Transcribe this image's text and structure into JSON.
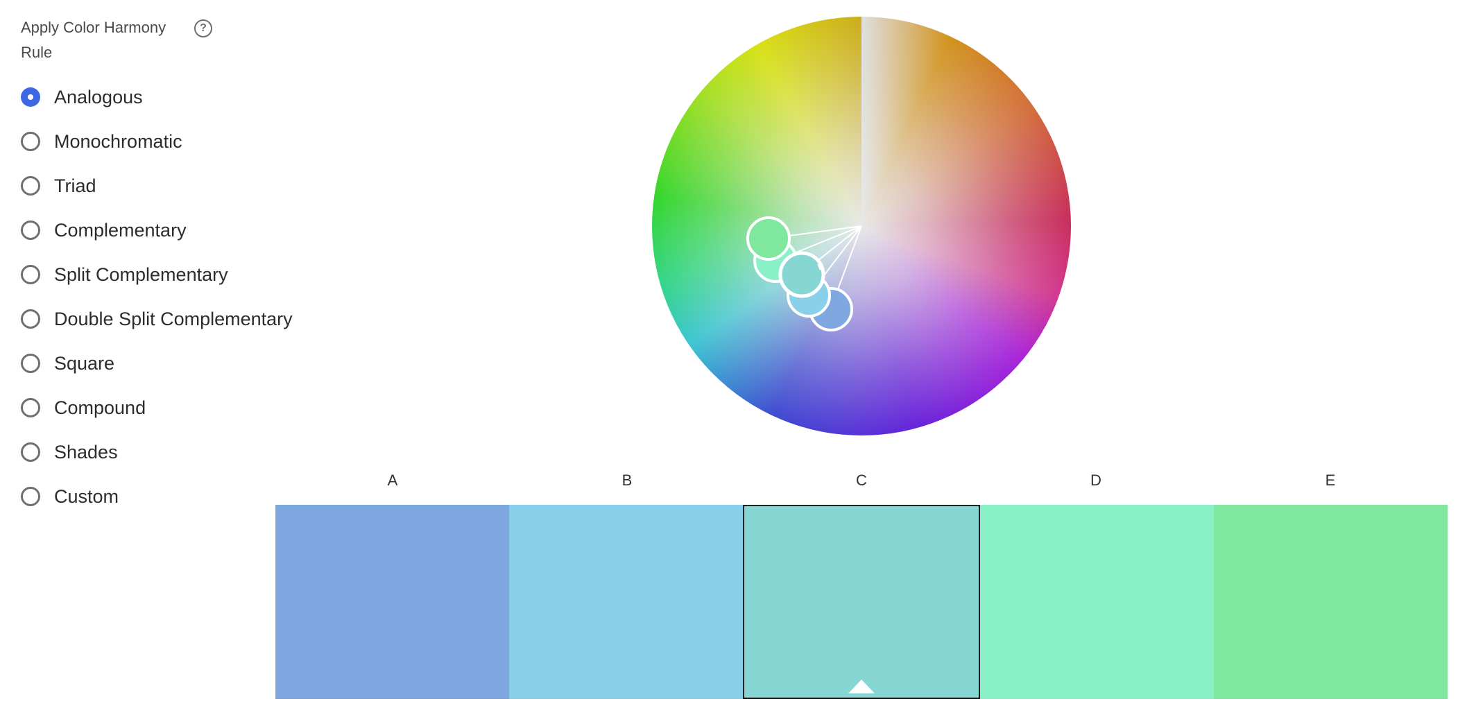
{
  "harmony_panel": {
    "title": "Apply Color Harmony Rule",
    "help_icon": "question-circle-icon",
    "help_glyph": "?",
    "selected_rule": "Analogous",
    "rules": [
      {
        "label": "Analogous",
        "selected": true
      },
      {
        "label": "Monochromatic",
        "selected": false
      },
      {
        "label": "Triad",
        "selected": false
      },
      {
        "label": "Complementary",
        "selected": false
      },
      {
        "label": "Split Complementary",
        "selected": false
      },
      {
        "label": "Double Split Complementary",
        "selected": false
      },
      {
        "label": "Square",
        "selected": false
      },
      {
        "label": "Compound",
        "selected": false
      },
      {
        "label": "Shades",
        "selected": false
      },
      {
        "label": "Custom",
        "selected": false
      }
    ]
  },
  "swatches": {
    "active": "C",
    "items": [
      {
        "label": "A",
        "color": "#80a8e0"
      },
      {
        "label": "B",
        "color": "#89d0ea"
      },
      {
        "label": "C",
        "color": "#86d6d3"
      },
      {
        "label": "D",
        "color": "#8af0c8"
      },
      {
        "label": "E",
        "color": "#80e89e"
      }
    ]
  },
  "colors": {
    "accent": "#3f67e4",
    "radio_border": "#707070",
    "active_swatch_border": "#1f1f1f"
  }
}
